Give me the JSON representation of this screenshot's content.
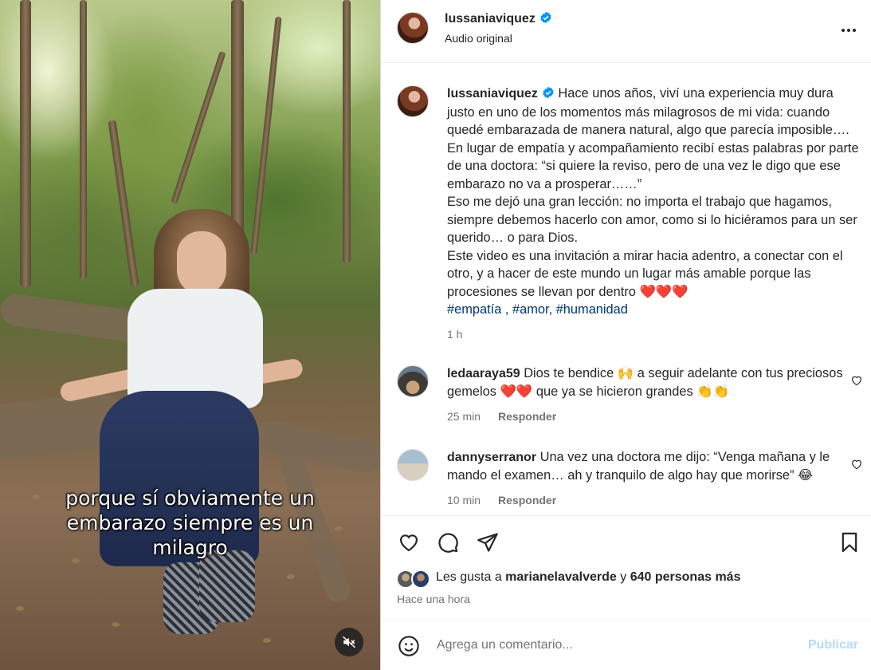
{
  "post": {
    "author": "lussaniaviquez",
    "audio": "Audio original",
    "caption": {
      "p1": "Hace unos años, viví una experiencia muy dura justo en uno de los momentos más milagrosos de mi vida: cuando quedé embarazada de manera natural, algo que parecía imposible…. En lugar de empatía y acompañamiento recibí estas palabras por parte de una doctora: “si quiere la reviso, pero de una vez le digo que ese embarazo no va a prosperar……”",
      "p2": "Eso me dejó una gran lección: no importa el trabajo que hagamos, siempre debemos hacerlo con amor, como si lo hiciéramos para un ser querido… o para Dios.",
      "p3": "Este video es una invitación a mirar hacia adentro, a conectar con el otro, y a hacer de este mundo un lugar más amable porque las procesiones se llevan por dentro ❤️❤️❤️",
      "hashtag1": "#empatía",
      "sep1": " , ",
      "hashtag2": "#amor",
      "sep2": ", ",
      "hashtag3": "#humanidad"
    },
    "time": "1 h"
  },
  "video": {
    "caption_lines": [
      "porque sí obviamente un",
      "embarazo siempre es un",
      "milagro"
    ]
  },
  "comments": [
    {
      "user": "ledaaraya59",
      "text": "Dios te bendice 🙌 a seguir adelante con tus preciosos gemelos ❤️❤️ que ya se hicieron grandes 👏👏",
      "time": "25 min",
      "reply": "Responder"
    },
    {
      "user": "dannyserranor",
      "text": "Una vez una doctora me dijo: “Venga mañana y le mando el examen… ah y tranquilo de algo hay que morirse” 😂",
      "time": "10 min",
      "reply": "Responder"
    }
  ],
  "actions": {
    "likes_prefix": "Les gusta a ",
    "liker": "marianelavalverde",
    "likes_mid": " y ",
    "likes_count": "640 personas más",
    "posted": "Hace una hora"
  },
  "comment_box": {
    "placeholder": "Agrega un comentario...",
    "post_label": "Publicar"
  },
  "colors": {
    "verified": "#0095f6",
    "hashtag": "#00376b",
    "publish_disabled": "#b3dbff"
  }
}
